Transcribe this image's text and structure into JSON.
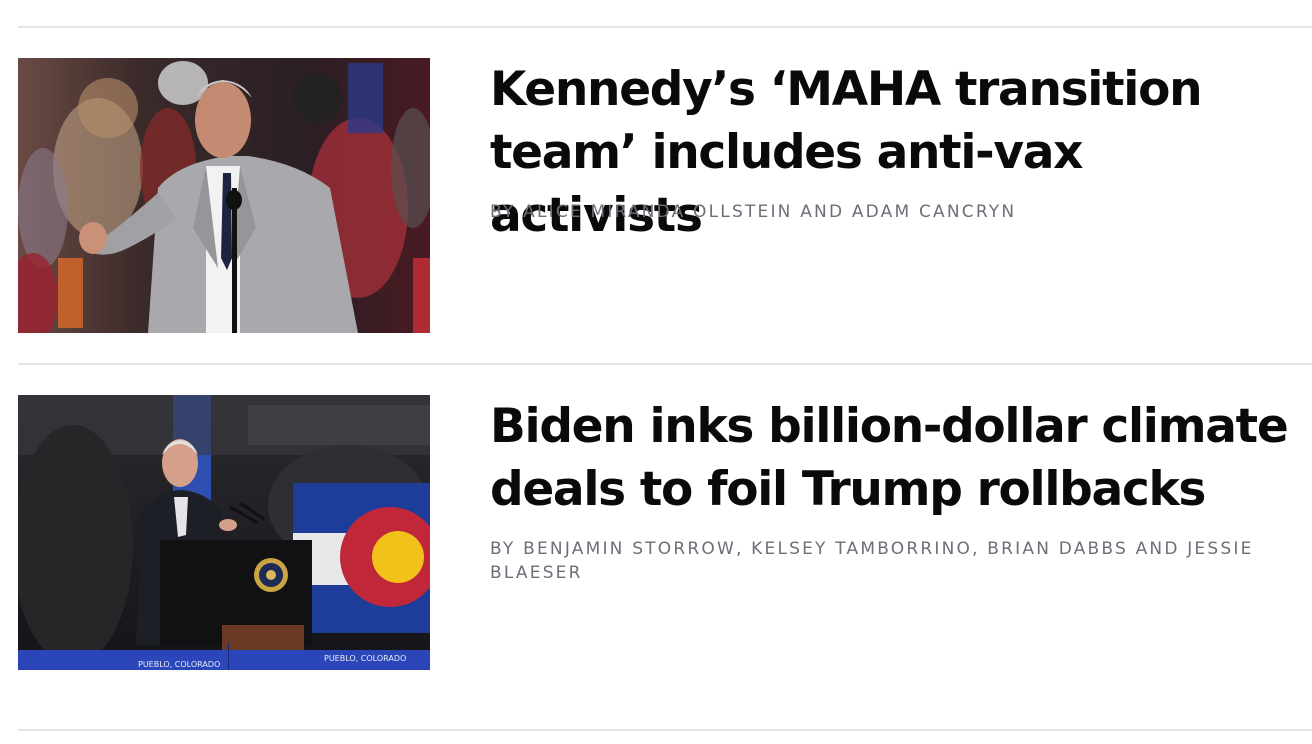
{
  "stories": [
    {
      "headline": "Kennedy’s ‘MAHA transition team’ includes anti-vax activists",
      "byline": "BY ALICE MIRANDA OLLSTEIN AND ADAM CANCRYN",
      "image": "photo-speaker-at-rally"
    },
    {
      "headline": "Biden inks billion-dollar climate deals to foil Trump rollbacks",
      "byline": "BY BENJAMIN STORROW, KELSEY TAMBORRINO, BRIAN DABBS AND JESSIE BLAESER",
      "image": "photo-president-at-podium",
      "banner_text": "PUEBLO, COLORADO"
    }
  ],
  "colors": {
    "headline": "#0a0a0a",
    "byline": "#6e6e78",
    "divider": "#e4e4e4"
  }
}
